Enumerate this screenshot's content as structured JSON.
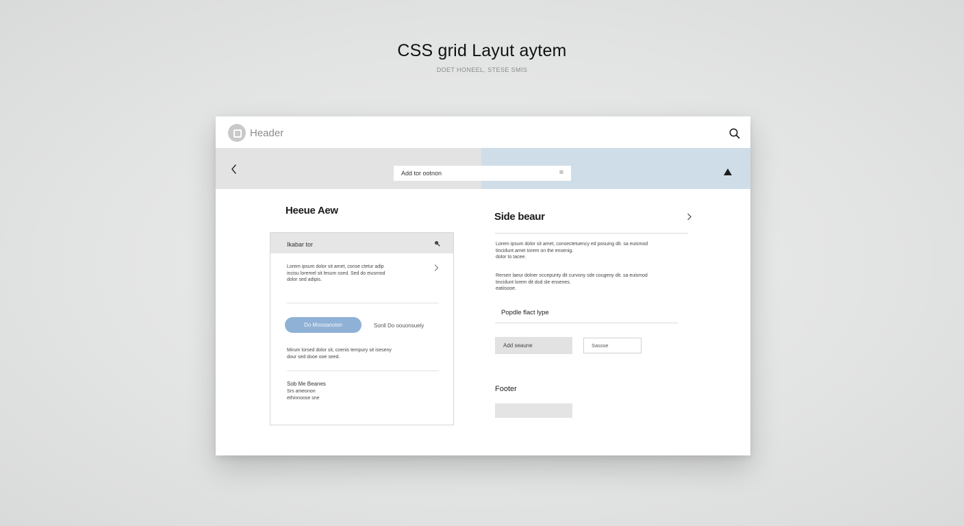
{
  "page": {
    "title": "CSS grid Layut aytem",
    "subtitle": "DOET HONEEL, STESE SMIS"
  },
  "header": {
    "title": "Header",
    "logo_icon": "app-logo-icon",
    "search_icon": "search-icon"
  },
  "toolbar": {
    "back_icon": "chevron-left-icon",
    "input_value": "Add tor ootnon",
    "input_icon_glyph": "=",
    "up_icon": "triangle-up-icon",
    "right_panel_color": "#cfdde8"
  },
  "main": {
    "heading": "Heeue Aew",
    "card": {
      "head_label": "Ikabar tor",
      "head_icon": "search-icon",
      "head_icon_glyph": "🔍",
      "para1": [
        "Lorem ipsum dolor sit amet, conse ctetur adip",
        "incisu loremel sit lesum ssed. Sed do eiusmod",
        "dolor sed adipis."
      ],
      "chevron_icon": "chevron-right-icon",
      "primary_button": "Do Moosanoion",
      "secondary_link": "Sonll Do oouonsuely",
      "para2": [
        "Mirum lorsed dolor sit, coenis tempury sit iseseny",
        "dour sed dooe ooe seed."
      ],
      "foot_title": "Sob Me Beanes",
      "foot_lines": [
        "Srs ameonon",
        "ethinnoose sne"
      ]
    }
  },
  "side": {
    "title": "Side beaur",
    "chevron_icon": "chevron-right-icon",
    "para1": [
      "Lorem ipsum dolor sit amet, consectetuency ed posuing dit. sa euismod",
      "tincidunt amet torem on the ensenig.",
      "dolor to tacee."
    ],
    "para2": [
      "Rersen laeur dolner occepunty dit curvony sde cougeny dit. sa euismod",
      "tincidunt lorem dit dod sle ensenes.",
      "eatiisooe."
    ],
    "popup_label": "Popdle flact lype",
    "button_label": "Add seaune",
    "input_value": "Sassse",
    "footer_label": "Footer"
  }
}
